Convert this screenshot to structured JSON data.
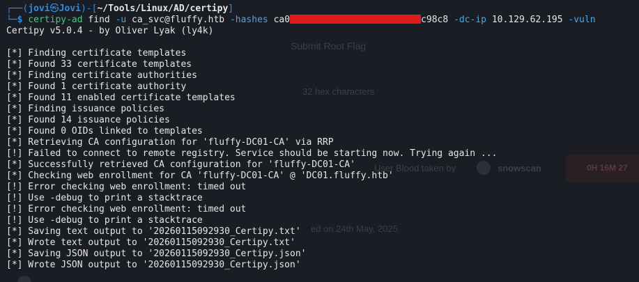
{
  "prompt": {
    "box_top_left": "┌──(",
    "user": "jovi",
    "at_symbol": "㉿",
    "host": "Jovi",
    "bracket_mid": ")-[",
    "path": "~/Tools/Linux/AD/certipy",
    "bracket_end": "]",
    "box_bottom_left": "└─",
    "symbol": "$"
  },
  "command": {
    "program": "certipy-ad",
    "subcommand": "find",
    "flag_user": "-u",
    "user_value": "ca_svc@fluffy.htb",
    "flag_hashes": "-hashes",
    "hash_prefix": "ca0",
    "redaction_color": "#e11b1b",
    "hash_suffix": "c98c8",
    "flag_dcip": "-dc-ip",
    "dcip_value": "10.129.62.195",
    "flag_vuln": "-vuln"
  },
  "banner": "Certipy v5.0.4 - by Oliver Lyak (ly4k)",
  "output_lines": [
    "[*] Finding certificate templates",
    "[*] Found 33 certificate templates",
    "[*] Finding certificate authorities",
    "[*] Found 1 certificate authority",
    "[*] Found 11 enabled certificate templates",
    "[*] Finding issuance policies",
    "[*] Found 14 issuance policies",
    "[*] Found 0 OIDs linked to templates",
    "[*] Retrieving CA configuration for 'fluffy-DC01-CA' via RRP",
    "[!] Failed to connect to remote registry. Service should be starting now. Trying again ...",
    "[*] Successfully retrieved CA configuration for 'fluffy-DC01-CA'",
    "[*] Checking web enrollment for CA 'fluffy-DC01-CA' @ 'DC01.fluffy.htb'",
    "[!] Error checking web enrollment: timed out",
    "[!] Use -debug to print a stacktrace",
    "[!] Error checking web enrollment: timed out",
    "[!] Use -debug to print a stacktrace",
    "[*] Saving text output to '20260115092930_Certipy.txt'",
    "[*] Wrote text output to '20260115092930_Certipy.txt'",
    "[*] Saving JSON output to '20260115092930_Certipy.json'",
    "[*] Wrote JSON output to '20260115092930_Certipy.json'"
  ],
  "background_ghost": {
    "submit_root_flag": "Submit Root Flag",
    "hash_chars": "32 hex characters",
    "blood_taken_by": "User Blood taken by",
    "blood_user": "snowscan",
    "badge": "0H 16M 27",
    "released": "ed on 24th May, 2025"
  },
  "colors": {
    "background": "#1b1d24",
    "prompt_blue": "#2f8be0",
    "command_green": "#43c97b",
    "option_blue": "#4fa3e0",
    "text": "#e6e6e6"
  }
}
